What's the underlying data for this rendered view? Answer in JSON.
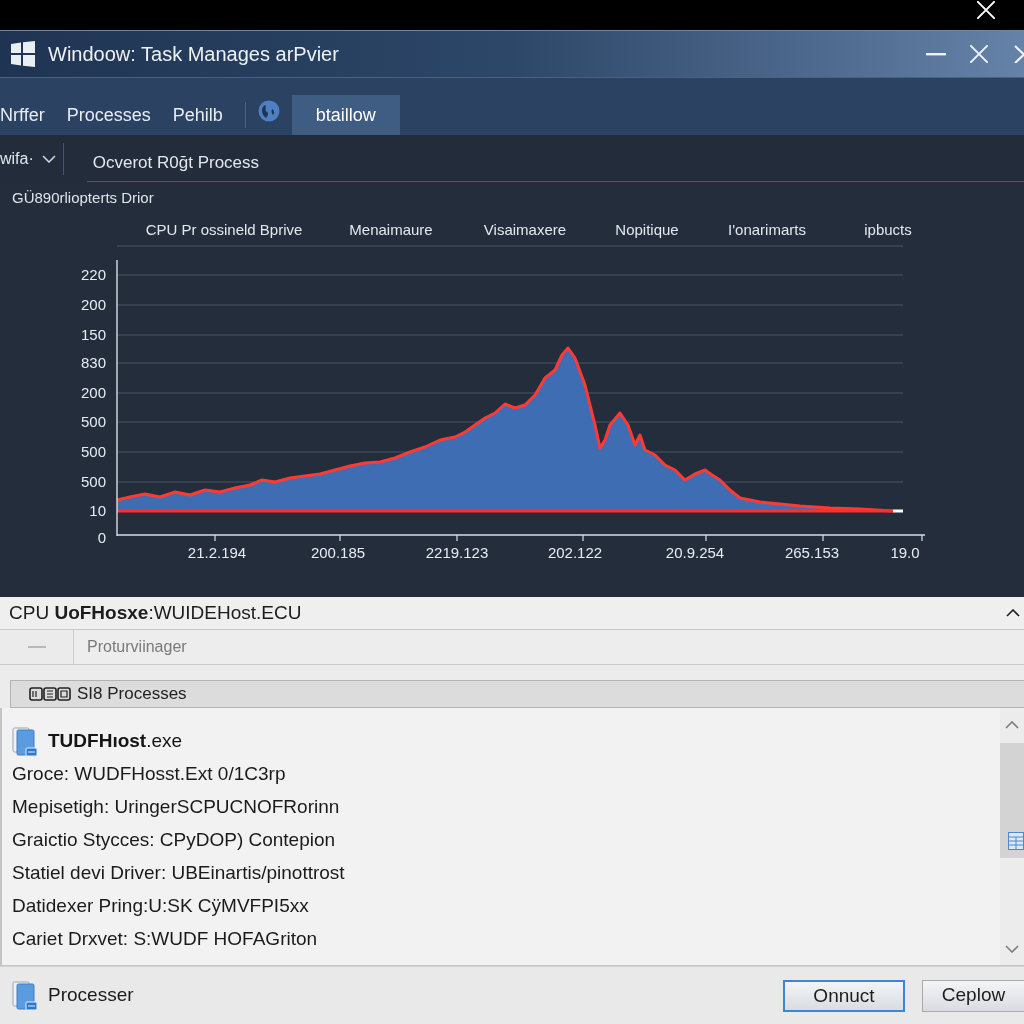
{
  "window": {
    "title": "Windoow: Task Manages arPvier"
  },
  "menu": {
    "items": [
      {
        "kind": "tab",
        "label": "Nrffer",
        "selected": false
      },
      {
        "kind": "tab",
        "label": "Processes",
        "selected": false
      },
      {
        "kind": "tab",
        "label": "Pehilb",
        "selected": false
      },
      {
        "kind": "separator"
      },
      {
        "kind": "globe"
      },
      {
        "kind": "tab",
        "label": "btaillow",
        "selected": true
      }
    ]
  },
  "toolbar": {
    "dropdown": {
      "label": "wifa·"
    },
    "title": "Ocverot R0ğt Process"
  },
  "section_label": "GÜ890rliopterts Drior",
  "chart": {
    "column_headers": [
      "CPU Pr ossineld Bprive",
      "Menaimaure",
      "Visaimaxere",
      "Nopitique",
      "I'onarimarts",
      "ipbucts"
    ],
    "y_labels": [
      "220",
      "200",
      "150",
      "830",
      "200",
      "500",
      "500",
      "500",
      "10",
      "0"
    ],
    "x_labels": [
      "21.2.194",
      "200.185",
      "2219.123",
      "202.122",
      "20.9.254",
      "265.153",
      "19.0"
    ]
  },
  "details_panel": {
    "title": "CPU **UoFHosxe**:WUIDEHost.ECU",
    "filter": {
      "placeholder": "Proturviinager"
    },
    "group": {
      "label": "SI8 Processes"
    },
    "item": {
      "title": "**TUDFHıost**.exe",
      "lines": [
        "Groce: WUDFHosst.Ext 0/1C3rp",
        "Mepisetigh: UringerSCPUCNOFRorinn",
        "Graictio Stycces: CPyDOP) Contepion",
        "Statiel devi Driver: UBEinartis/pinottrost",
        "Datidexer Pring:U:SK CÿMVFPI5xx",
        "Cariet Drxvet: S:WUDF HOFAGriton"
      ]
    }
  },
  "footer": {
    "label": "Processer",
    "buttons": [
      {
        "label": "Onnuct",
        "default": true
      },
      {
        "label": "Ceplow",
        "default": false
      }
    ]
  }
}
